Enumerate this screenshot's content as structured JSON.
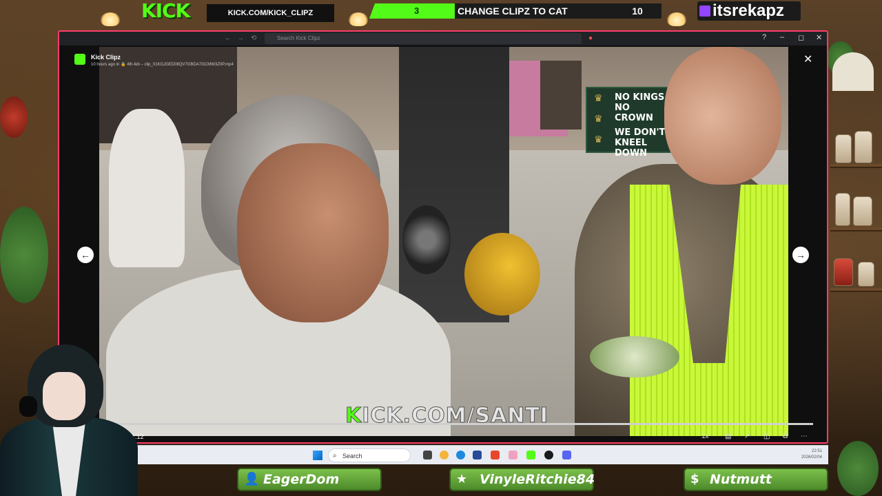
{
  "overlay": {
    "kick_logo": "KICK",
    "kick_url": "KICK.COM/KICK_CLIPZ",
    "poll": {
      "left_count": "3",
      "prompt": "CHANGE CLIPZ TO CAT",
      "right_count": "10"
    },
    "twitch_handle": "itsrekapz",
    "chat_chips": [
      {
        "icon": "user-icon",
        "glyph": "👤",
        "name": "EagerDom"
      },
      {
        "icon": "star-icon",
        "glyph": "★",
        "name": "VinyleRitchie84"
      },
      {
        "icon": "dollar-icon",
        "glyph": "$",
        "name": "Nutmutt"
      }
    ]
  },
  "window": {
    "search_placeholder": "Search Kick Clipz",
    "controls": {
      "help": "?",
      "minimize": "–",
      "maximize": "◻",
      "close": "✕"
    }
  },
  "viewer": {
    "app_name": "Kick Clipz",
    "meta": "10 hours ago in 🔒 4th-feb  – clip_01KGJGED08QV7GBDA7GCMW3Z0P.mp4",
    "close": "✕",
    "prev": "←",
    "next": "→",
    "sign_lines": [
      "NO KINGS",
      "NO CROWN",
      "WE DON'T",
      "KNEEL DOWN"
    ],
    "watermark_k": "K",
    "watermark_rest": "ICK.COM/SANTI",
    "time": "0:00 / 1:12",
    "speed": "1x",
    "progress": 0.0
  },
  "taskbar": {
    "search": "Search",
    "clock_time": "22:51",
    "clock_date": "2026/02/04"
  },
  "colors": {
    "kick_green": "#53fc18",
    "window_border": "#ff3b6b",
    "twitch_purple": "#9146ff"
  }
}
